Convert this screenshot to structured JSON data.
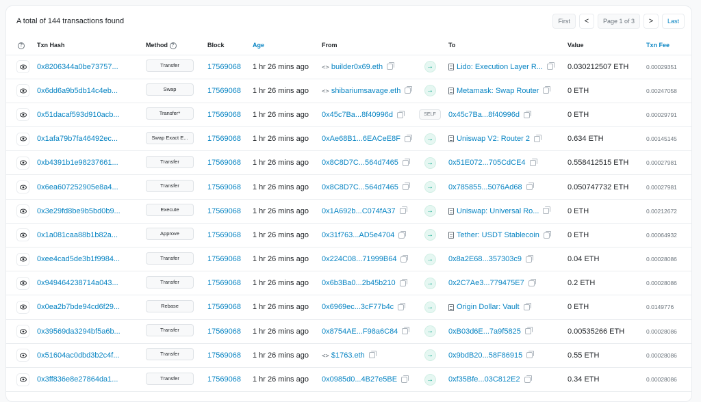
{
  "summary": "A total of 144 transactions found",
  "pagination": {
    "first": "First",
    "prev": "<",
    "page": "Page 1 of 3",
    "next": ">",
    "last": "Last"
  },
  "columns": {
    "help": "?",
    "txn_hash": "Txn Hash",
    "method": "Method",
    "block": "Block",
    "age": "Age",
    "from": "From",
    "to": "To",
    "value": "Value",
    "fee": "Txn Fee"
  },
  "rows": [
    {
      "hash": "0x8206344a0be73757...",
      "method": "Transfer",
      "block": "17569068",
      "age": "1 hr 26 mins ago",
      "from": "builder0x69.eth",
      "from_icon": "code-icon",
      "direction": "out",
      "to": "Lido: Execution Layer R...",
      "to_icon": "contract-icon",
      "value": "0.030212507 ETH",
      "fee": "0.00029351"
    },
    {
      "hash": "0x6dd6a9b5db14c4eb...",
      "method": "Swap",
      "block": "17569068",
      "age": "1 hr 26 mins ago",
      "from": "shibariumsavage.eth",
      "from_icon": "code-icon",
      "direction": "out",
      "to": "Metamask: Swap Router",
      "to_icon": "contract-icon",
      "value": "0 ETH",
      "fee": "0.00247058"
    },
    {
      "hash": "0x51dacaf593d910acb...",
      "method": "Transfer*",
      "block": "17569068",
      "age": "1 hr 26 mins ago",
      "from": "0x45c7Ba...8f40996d",
      "from_icon": "",
      "direction": "SELF",
      "to": "0x45c7Ba...8f40996d",
      "to_icon": "",
      "value": "0 ETH",
      "fee": "0.00029791"
    },
    {
      "hash": "0x1afa79b7fa46492ec...",
      "method": "Swap Exact E...",
      "block": "17569068",
      "age": "1 hr 26 mins ago",
      "from": "0xAe68B1...6EACeE8F",
      "from_icon": "",
      "direction": "out",
      "to": "Uniswap V2: Router 2",
      "to_icon": "contract-icon",
      "value": "0.634 ETH",
      "fee": "0.00145145"
    },
    {
      "hash": "0xb4391b1e98237661...",
      "method": "Transfer",
      "block": "17569068",
      "age": "1 hr 26 mins ago",
      "from": "0x8C8D7C...564d7465",
      "from_icon": "",
      "direction": "out",
      "to": "0x51E072...705CdCE4",
      "to_icon": "",
      "value": "0.558412515 ETH",
      "fee": "0.00027981"
    },
    {
      "hash": "0x6ea607252905e8a4...",
      "method": "Transfer",
      "block": "17569068",
      "age": "1 hr 26 mins ago",
      "from": "0x8C8D7C...564d7465",
      "from_icon": "",
      "direction": "out",
      "to": "0x785855...5076Ad68",
      "to_icon": "",
      "value": "0.050747732 ETH",
      "fee": "0.00027981"
    },
    {
      "hash": "0x3e29fd8be9b5bd0b9...",
      "method": "Execute",
      "block": "17569068",
      "age": "1 hr 26 mins ago",
      "from": "0x1A692b...C074fA37",
      "from_icon": "",
      "direction": "out",
      "to": "Uniswap: Universal Ro...",
      "to_icon": "contract-icon",
      "value": "0 ETH",
      "fee": "0.00212672"
    },
    {
      "hash": "0x1a081caa88b1b82a...",
      "method": "Approve",
      "block": "17569068",
      "age": "1 hr 26 mins ago",
      "from": "0x31f763...AD5e4704",
      "from_icon": "",
      "direction": "out",
      "to": "Tether: USDT Stablecoin",
      "to_icon": "contract-icon",
      "value": "0 ETH",
      "fee": "0.00064932"
    },
    {
      "hash": "0xee4cad5de3b1f9984...",
      "method": "Transfer",
      "block": "17569068",
      "age": "1 hr 26 mins ago",
      "from": "0x224C08...71999B64",
      "from_icon": "",
      "direction": "out",
      "to": "0x8a2E68...357303c9",
      "to_icon": "",
      "value": "0.04 ETH",
      "fee": "0.00028086"
    },
    {
      "hash": "0x949464238714a043...",
      "method": "Transfer",
      "block": "17569068",
      "age": "1 hr 26 mins ago",
      "from": "0x6b3Ba0...2b45b210",
      "from_icon": "",
      "direction": "out",
      "to": "0x2C7Ae3...779475E7",
      "to_icon": "",
      "value": "0.2 ETH",
      "fee": "0.00028086"
    },
    {
      "hash": "0x0ea2b7bde94cd6f29...",
      "method": "Rebase",
      "block": "17569068",
      "age": "1 hr 26 mins ago",
      "from": "0x6969ec...3cF77b4c",
      "from_icon": "",
      "direction": "out",
      "to": "Origin Dollar: Vault",
      "to_icon": "contract-icon",
      "value": "0 ETH",
      "fee": "0.0149776"
    },
    {
      "hash": "0x39569da3294bf5a6b...",
      "method": "Transfer",
      "block": "17569068",
      "age": "1 hr 26 mins ago",
      "from": "0x8754AE...F98a6C84",
      "from_icon": "",
      "direction": "out",
      "to": "0xB03d6E...7a9f5825",
      "to_icon": "",
      "value": "0.00535266 ETH",
      "fee": "0.00028086"
    },
    {
      "hash": "0x51604ac0dbd3b2c4f...",
      "method": "Transfer",
      "block": "17569068",
      "age": "1 hr 26 mins ago",
      "from": "$1763.eth",
      "from_icon": "code-icon",
      "direction": "out",
      "to": "0x9bdB20...58F86915",
      "to_icon": "",
      "value": "0.55 ETH",
      "fee": "0.00028086"
    },
    {
      "hash": "0x3ff836e8e27864da1...",
      "method": "Transfer",
      "block": "17569068",
      "age": "1 hr 26 mins ago",
      "from": "0x0985d0...4B27e5BE",
      "from_icon": "",
      "direction": "out",
      "to": "0xf35Bfe...03C812E2",
      "to_icon": "",
      "value": "0.34 ETH",
      "fee": "0.00028086"
    }
  ],
  "colors": {
    "link": "#0784c3",
    "arrow": "#00a186",
    "border": "#e9ecef"
  }
}
